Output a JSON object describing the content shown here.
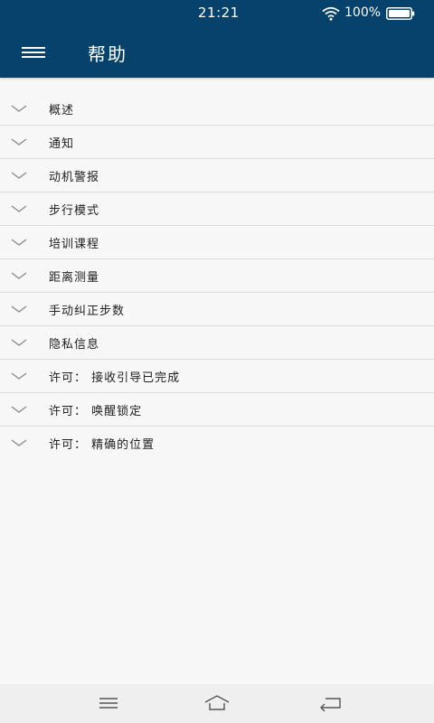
{
  "status_bar": {
    "time": "21:21",
    "battery": "100%"
  },
  "app_bar": {
    "title": "帮助"
  },
  "help_items": [
    {
      "label": "概述"
    },
    {
      "label": "通知"
    },
    {
      "label": "动机警报"
    },
    {
      "label": "步行模式"
    },
    {
      "label": "培训课程"
    },
    {
      "label": "距离测量"
    },
    {
      "label": "手动纠正步数"
    },
    {
      "label": "隐私信息"
    },
    {
      "label": "许可：  接收引导已完成"
    },
    {
      "label": "许可：  唤醒锁定"
    },
    {
      "label": "许可：  精确的位置"
    }
  ],
  "colors": {
    "primary": "#06426b",
    "background": "#f7f7f7",
    "divider": "#dcdcdc",
    "chevron": "#8c8c8c"
  },
  "icons": {
    "menu": "menu-icon",
    "expand": "chevron-down-icon",
    "nav_recent": "recent-apps-icon",
    "nav_home": "home-icon",
    "nav_back": "back-icon"
  }
}
